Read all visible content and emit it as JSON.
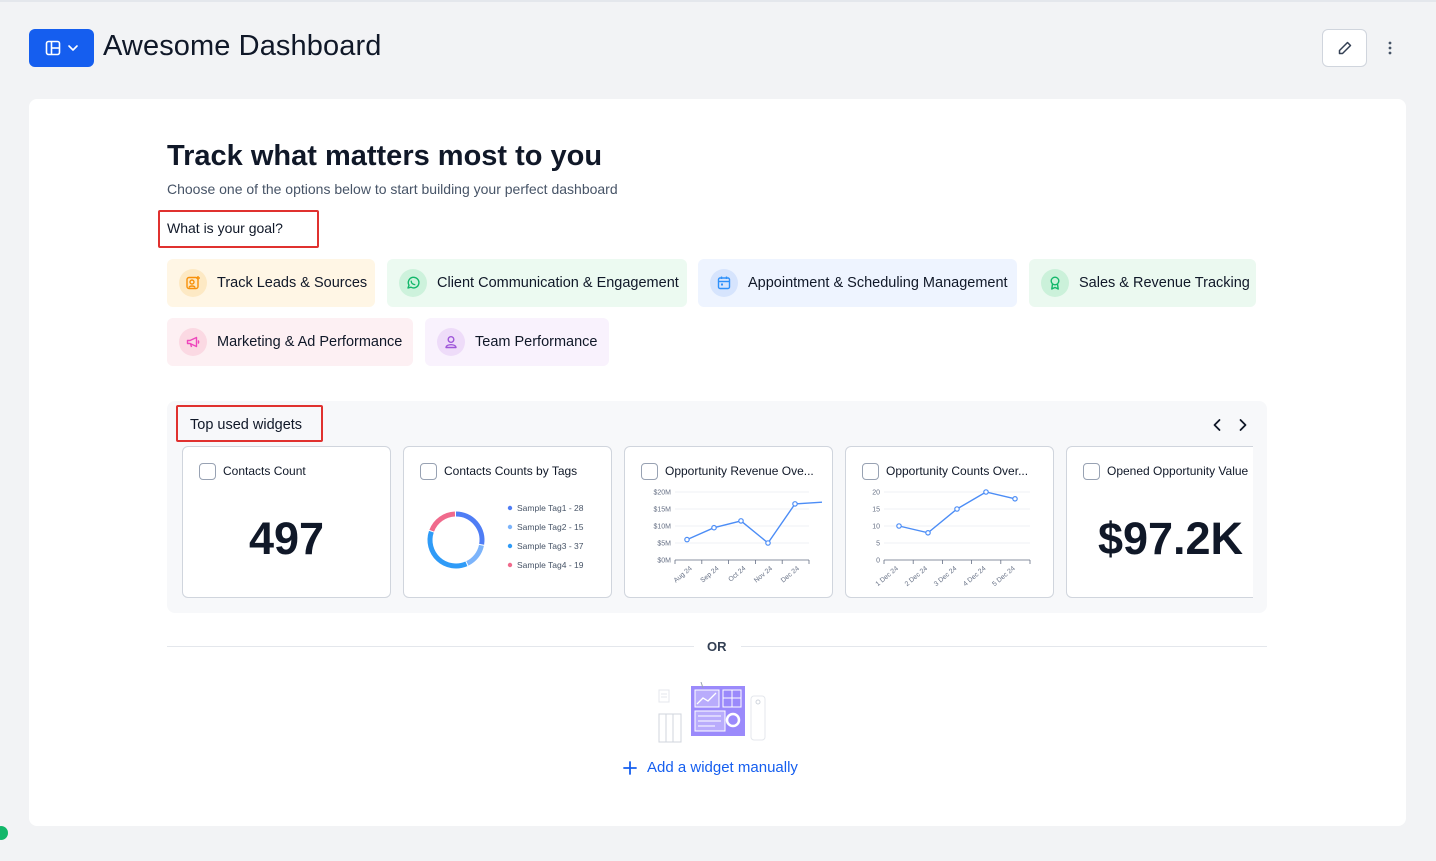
{
  "header": {
    "title": "Awesome Dashboard"
  },
  "main": {
    "headline": "Track what matters most to you",
    "subline": "Choose one of the options below to start building your perfect dashboard",
    "goal_label": "What is your goal?",
    "goals": [
      {
        "label": "Track Leads & Sources",
        "icon": "user-plus-icon",
        "bg": "#fff6e5",
        "icon_bg": "#fde9c4",
        "icon_color": "#f79009"
      },
      {
        "label": "Client Communication & Engagement",
        "icon": "whatsapp-icon",
        "bg": "#ecfaf1",
        "icon_bg": "#cdf2dc",
        "icon_color": "#12b76a"
      },
      {
        "label": "Appointment & Scheduling Management",
        "icon": "calendar-icon",
        "bg": "#eef4ff",
        "icon_bg": "#d6e4fd",
        "icon_color": "#2e90fa"
      },
      {
        "label": "Sales & Revenue Tracking",
        "icon": "award-icon",
        "bg": "#ebf9f0",
        "icon_bg": "#cbf1da",
        "icon_color": "#12b76a"
      },
      {
        "label": "Marketing & Ad Performance",
        "icon": "megaphone-icon",
        "bg": "#fdf0f3",
        "icon_bg": "#fbd9e3",
        "icon_color": "#ee46bc"
      },
      {
        "label": "Team Performance",
        "icon": "user-icon",
        "bg": "#f9f2fd",
        "icon_bg": "#eedcf9",
        "icon_color": "#9e55d9"
      }
    ],
    "widgets_label": "Top used widgets",
    "widgets": [
      {
        "title": "Contacts Count",
        "value": "497"
      },
      {
        "title": "Contacts Counts by Tags",
        "legend": [
          "Sample Tag1 - 28",
          "Sample Tag2 - 15",
          "Sample Tag3 - 37",
          "Sample Tag4 - 19"
        ]
      },
      {
        "title": "Opportunity Revenue Ove...",
        "y_ticks": [
          "$20M",
          "$15M",
          "$10M",
          "$5M",
          "$0M"
        ],
        "x_ticks": [
          "Aug 24",
          "Sep 24",
          "Oct 24",
          "Nov 24",
          "Dec 24"
        ]
      },
      {
        "title": "Opportunity Counts Over...",
        "y_ticks": [
          "20",
          "15",
          "10",
          "5",
          "0"
        ],
        "x_ticks": [
          "1 Dec 24",
          "2 Dec 24",
          "3 Dec 24",
          "4 Dec 24",
          "5 Dec 24"
        ]
      },
      {
        "title": "Opened Opportunity Value",
        "value": "$97.2K"
      }
    ],
    "or_text": "OR",
    "add_widget_label": "Add a widget manually"
  },
  "colors": {
    "accent": "#155eef",
    "line_series": "#4c8df6",
    "annotation_box": "#e0312f"
  },
  "chart_data": [
    {
      "type": "pie",
      "title": "Contacts Counts by Tags",
      "categories": [
        "Sample Tag1",
        "Sample Tag2",
        "Sample Tag3",
        "Sample Tag4"
      ],
      "values": [
        28,
        15,
        37,
        19
      ],
      "colors": [
        "#4f7df5",
        "#7cb4fb",
        "#2f9bf7",
        "#f06a8c"
      ]
    },
    {
      "type": "line",
      "title": "Opportunity Revenue Ove...",
      "x": [
        "Aug 24",
        "Sep 24",
        "Oct 24",
        "Nov 24",
        "Dec 24"
      ],
      "points_x": [
        0,
        1,
        2,
        3,
        4,
        5
      ],
      "values": [
        6,
        9.5,
        11.5,
        5,
        16.5,
        17
      ],
      "ylim": [
        0,
        20
      ],
      "y_unit": "$M"
    },
    {
      "type": "line",
      "title": "Opportunity Counts Over...",
      "x": [
        "1 Dec 24",
        "2 Dec 24",
        "3 Dec 24",
        "4 Dec 24",
        "5 Dec 24"
      ],
      "values": [
        10,
        8,
        15,
        20,
        18
      ],
      "ylim": [
        0,
        20
      ]
    }
  ]
}
